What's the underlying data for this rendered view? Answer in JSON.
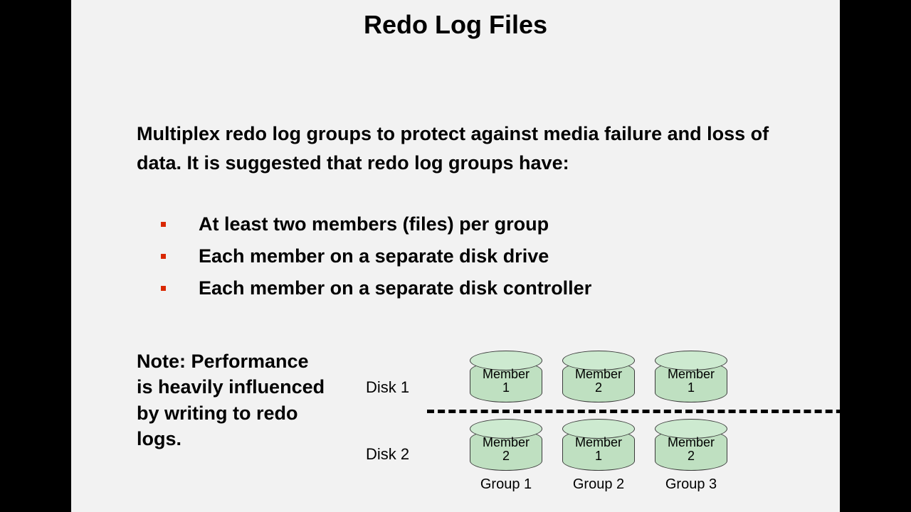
{
  "title": "Redo Log Files",
  "body": "Multiplex redo log groups to protect against media failure and loss of data. It is suggested that redo log groups have:",
  "bullets": [
    "At least two members (files) per group",
    "Each member on a separate disk drive",
    "Each member on a separate disk controller"
  ],
  "note": "Note: Performance is heavily influenced by writing to redo logs.",
  "diagram": {
    "disk_labels": [
      "Disk 1",
      "Disk 2"
    ],
    "group_labels": [
      "Group 1",
      "Group 2",
      "Group 3"
    ],
    "row1": [
      {
        "line1": "Member",
        "line2": "1"
      },
      {
        "line1": "Member",
        "line2": "2"
      },
      {
        "line1": "Member",
        "line2": "1"
      }
    ],
    "row2": [
      {
        "line1": "Member",
        "line2": "2"
      },
      {
        "line1": "Member",
        "line2": "1"
      },
      {
        "line1": "Member",
        "line2": "2"
      }
    ]
  }
}
